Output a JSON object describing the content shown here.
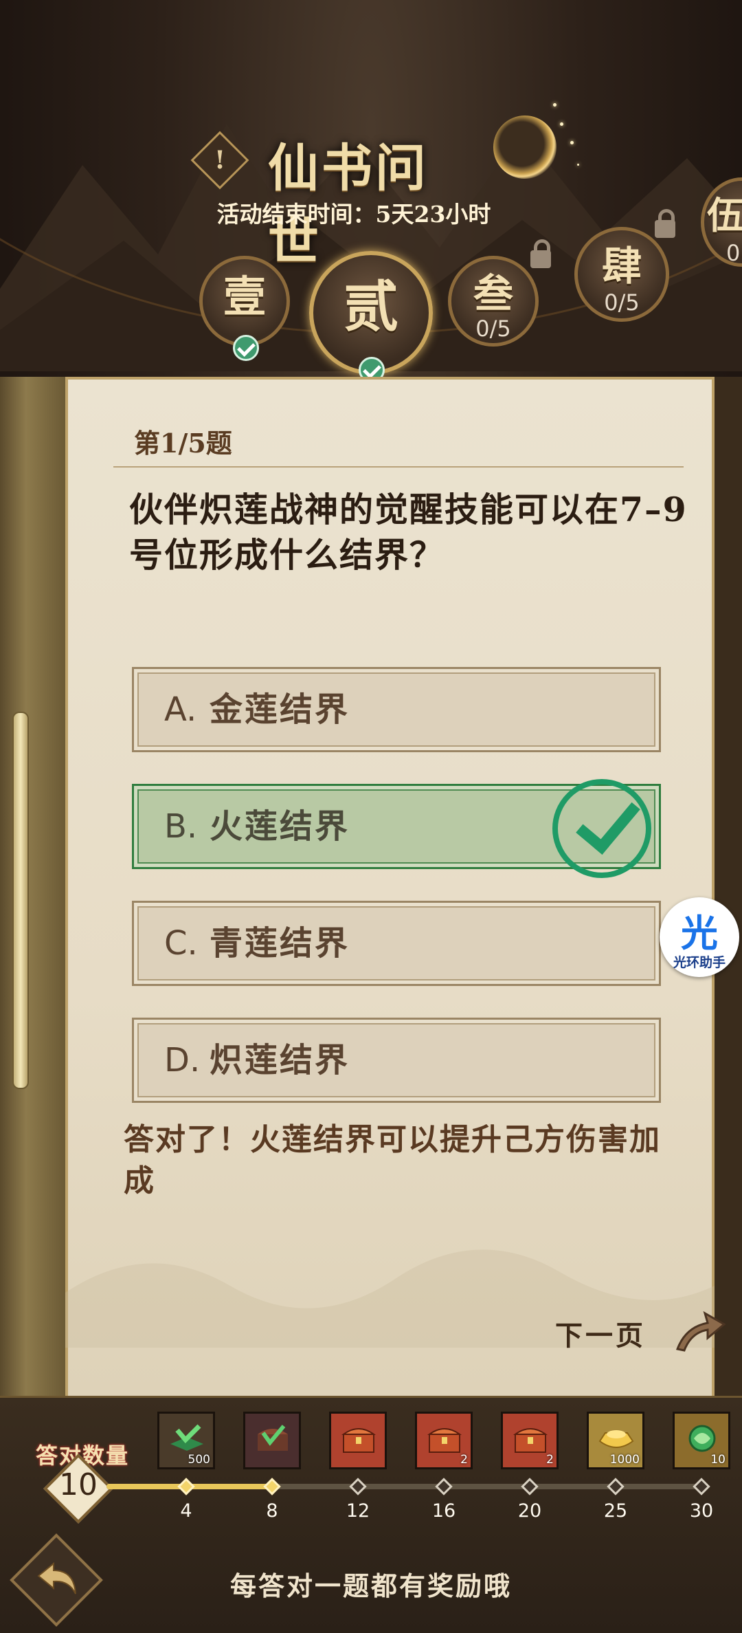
{
  "header": {
    "title": "仙书问世",
    "info_icon": "!",
    "countdown_label": "活动结束时间：",
    "countdown_value": "5天23小时"
  },
  "chapters": [
    {
      "label": "壹",
      "progress": "",
      "status": "completed"
    },
    {
      "label": "贰",
      "progress": "",
      "status": "completed-selected"
    },
    {
      "label": "叁",
      "progress": "0/5",
      "status": "locked"
    },
    {
      "label": "肆",
      "progress": "0/5",
      "status": "locked"
    },
    {
      "label": "伍",
      "progress": "0",
      "status": "locked"
    }
  ],
  "question": {
    "number": "第1/5题",
    "text": "伙伴炽莲战神的觉醒技能可以在7–9号位形成什么结界？",
    "options": [
      {
        "letter": "A.",
        "text": "金莲结界",
        "state": "normal"
      },
      {
        "letter": "B.",
        "text": "火莲结界",
        "state": "correct"
      },
      {
        "letter": "C.",
        "text": "青莲结界",
        "state": "normal"
      },
      {
        "letter": "D.",
        "text": "炽莲结界",
        "state": "normal"
      }
    ],
    "explanation": "答对了！火莲结界可以提升己方伤害加成"
  },
  "next_page": {
    "label": "下一页",
    "icon": "curved-arrow-icon"
  },
  "helper": {
    "glyph": "光",
    "label": "光环助手"
  },
  "rewards": {
    "label": "答对数量",
    "correct_count": "10",
    "progress_fraction": 0.28,
    "milestones": [
      {
        "value": "4",
        "reached": true,
        "icon": "green-book-icon",
        "qty": "500",
        "bg": "#4a3b2a"
      },
      {
        "value": "8",
        "reached": true,
        "icon": "green-chest-icon",
        "qty": "",
        "bg": "#4a2e2e"
      },
      {
        "value": "12",
        "reached": false,
        "icon": "red-chest-icon",
        "qty": "",
        "bg": "#b0422e"
      },
      {
        "value": "16",
        "reached": false,
        "icon": "red-chest-icon",
        "qty": "2",
        "bg": "#b0422e"
      },
      {
        "value": "20",
        "reached": false,
        "icon": "red-chest-icon",
        "qty": "2",
        "bg": "#b0422e"
      },
      {
        "value": "25",
        "reached": false,
        "icon": "gold-ingot-icon",
        "qty": "1000",
        "bg": "#a88a3c"
      },
      {
        "value": "30",
        "reached": false,
        "icon": "jade-orb-icon",
        "qty": "10",
        "bg": "#8c6c2c"
      }
    ]
  },
  "footer": {
    "hint": "每答对一题都有奖励哦",
    "back_icon": "back-arrow-icon"
  },
  "colors": {
    "accent_gold": "#e8c75a",
    "correct_green": "#1f9b66",
    "paper": "#ebe3d0"
  }
}
